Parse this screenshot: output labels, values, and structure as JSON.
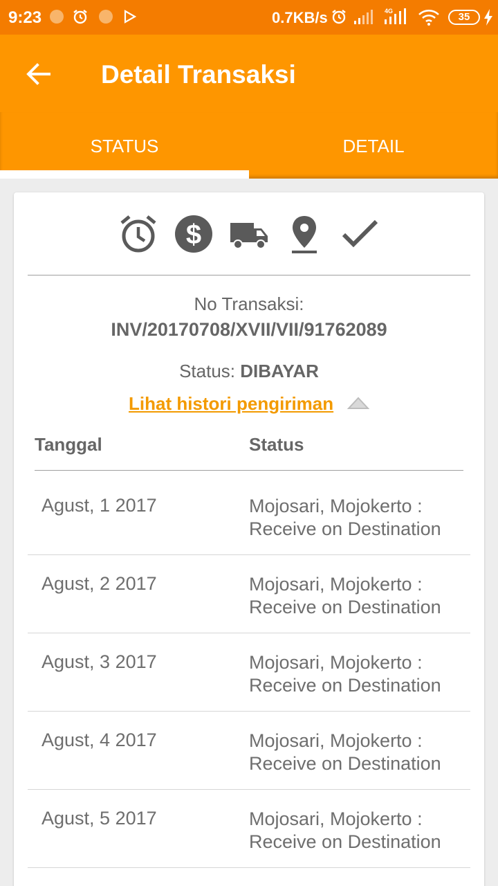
{
  "status_bar": {
    "time": "9:23",
    "speed": "0.7KB/s",
    "network": "4G",
    "battery": "35"
  },
  "app_bar": {
    "title": "Detail Transaksi",
    "back_icon": "arrow-left-icon"
  },
  "tabs": [
    {
      "label": "STATUS",
      "active": true
    },
    {
      "label": "DETAIL",
      "active": false
    }
  ],
  "progress_icons": [
    "alarm-clock-icon",
    "dollar-icon",
    "truck-icon",
    "location-pin-icon",
    "check-icon"
  ],
  "transaction": {
    "no_label": "No Transaksi:",
    "no_value": "INV/20170708/XVII/VII/91762089",
    "status_label": "Status: ",
    "status_value": "DIBAYAR",
    "history_link": "Lihat histori pengiriman"
  },
  "history_table": {
    "headers": {
      "date": "Tanggal",
      "status": "Status"
    },
    "rows": [
      {
        "date": "Agust, 1 2017",
        "status": "Mojosari, Mojokerto : Receive on Destination"
      },
      {
        "date": "Agust, 2 2017",
        "status": "Mojosari, Mojokerto : Receive on Destination"
      },
      {
        "date": "Agust, 3 2017",
        "status": "Mojosari, Mojokerto : Receive on Destination"
      },
      {
        "date": "Agust, 4 2017",
        "status": "Mojosari, Mojokerto : Receive on Destination"
      },
      {
        "date": "Agust, 5 2017",
        "status": "Mojosari, Mojokerto : Receive on Destination"
      }
    ]
  },
  "colors": {
    "status_bar": "#f47c00",
    "primary": "#fe9600",
    "link": "#f39a00",
    "icon": "#5a5a5a"
  }
}
